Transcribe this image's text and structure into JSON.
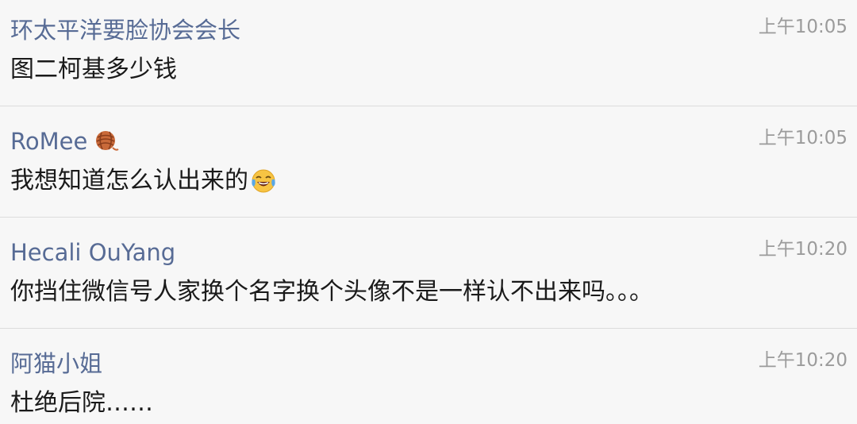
{
  "comments": [
    {
      "author": "环太平洋要脸协会会长",
      "time": "上午10:05",
      "text": "图二柯基多少钱"
    },
    {
      "author": "RoMee",
      "author_emoji": "yarn-ball-icon",
      "time": "上午10:05",
      "text": "我想知道怎么认出来的",
      "text_emoji": "tears-of-joy-emoji-icon"
    },
    {
      "author": "Hecali OuYang",
      "time": "上午10:20",
      "text": "你挡住微信号人家换个名字换个头像不是一样认不出来吗。。。"
    },
    {
      "author": "阿猫小姐",
      "time": "上午10:20",
      "text": "杜绝后院……"
    }
  ],
  "colors": {
    "author": "#576b95",
    "time": "#9b9b9b",
    "text": "#1a1a1a",
    "background": "#f7f7f7",
    "divider": "#dcdcdc"
  }
}
